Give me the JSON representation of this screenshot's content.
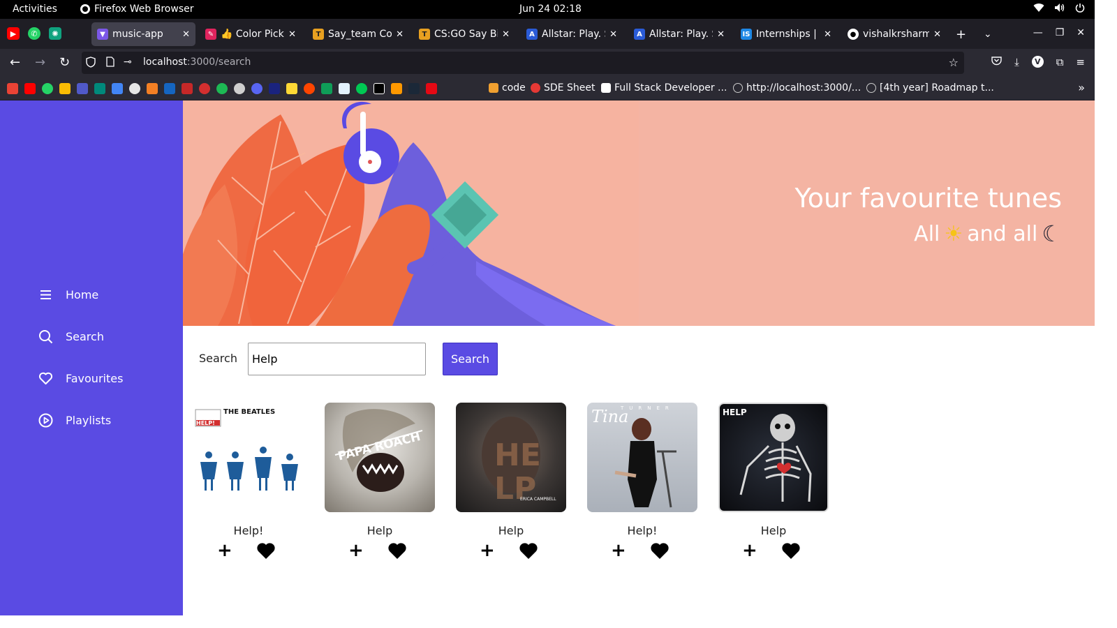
{
  "system_bar": {
    "activities": "Activities",
    "app_name": "Firefox Web Browser",
    "clock": "Jun 24  02:18"
  },
  "browser": {
    "tabs": [
      {
        "title": "music-app",
        "active": true,
        "favicon_color": "#7b57e8"
      },
      {
        "title": "👍 Color Picker",
        "active": false,
        "favicon_color": "#e0245e"
      },
      {
        "title": "Say_team Com",
        "active": false,
        "favicon_color": "#e8a020"
      },
      {
        "title": "CS:GO Say Binc",
        "active": false,
        "favicon_color": "#e8a020"
      },
      {
        "title": "Allstar: Play. Sh",
        "active": false,
        "favicon_color": "#2a5bd7"
      },
      {
        "title": "Allstar: Play. Sh",
        "active": false,
        "favicon_color": "#2a5bd7"
      },
      {
        "title": "Internships | St",
        "active": false,
        "favicon_color": "#1e88e5"
      },
      {
        "title": "vishalkrsharma",
        "active": false,
        "favicon_color": "#ffffff"
      }
    ],
    "url_host": "localhost",
    "url_path": ":3000/search",
    "bookmarks": [
      {
        "label": "code",
        "color": "#f0a030"
      },
      {
        "label": "SDE Sheet",
        "color": "#e53935"
      },
      {
        "label": "Full Stack Developer ...",
        "color": "#ffffff"
      },
      {
        "label": "http://localhost:3000/...",
        "color": "#cccccc"
      },
      {
        "label": "[4th year] Roadmap t...",
        "color": "#cccccc"
      }
    ]
  },
  "sidebar": {
    "items": [
      {
        "label": "Home",
        "icon": "menu-icon"
      },
      {
        "label": "Search",
        "icon": "search-icon"
      },
      {
        "label": "Favourites",
        "icon": "heart-outline-icon"
      },
      {
        "label": "Playlists",
        "icon": "play-circle-icon"
      }
    ]
  },
  "hero": {
    "title": "Your favourite tunes",
    "subtitle_start": "All",
    "subtitle_mid": "and all",
    "sun_icon": "☀",
    "moon_icon": "☾"
  },
  "search": {
    "label": "Search",
    "value": "Help",
    "button_label": "Search"
  },
  "results": [
    {
      "title": "Help!",
      "cover_text": "THE BEATLES",
      "cover_badge": "HELP!"
    },
    {
      "title": "Help",
      "cover_text": "PAPA ROACH",
      "cover_badge": ""
    },
    {
      "title": "Help",
      "cover_text": "ERICA CAMPBELL",
      "cover_badge": ""
    },
    {
      "title": "Help!",
      "cover_text": "Tina",
      "cover_badge": "TURNER"
    },
    {
      "title": "Help",
      "cover_text": "HELP",
      "cover_badge": ""
    }
  ],
  "colors": {
    "accent": "#5a4be3",
    "hero_bg": "#f6b3a0"
  }
}
